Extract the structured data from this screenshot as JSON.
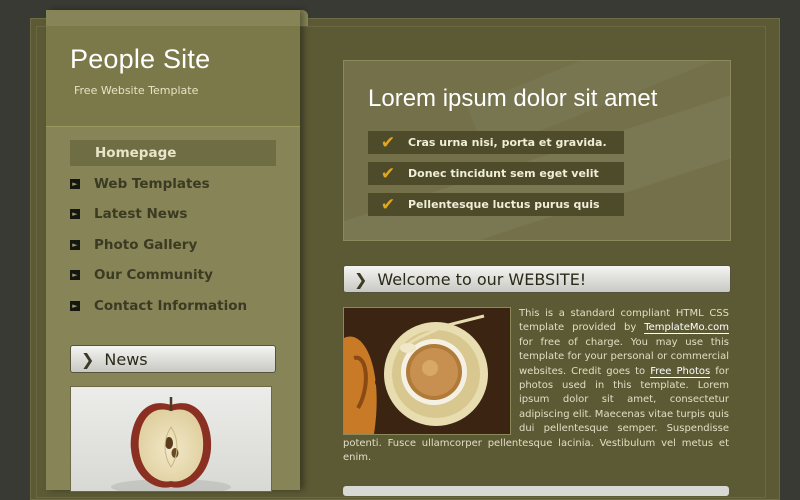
{
  "site": {
    "title": "People Site",
    "subtitle": "Free Website Template"
  },
  "nav": {
    "items": [
      {
        "label": "Homepage",
        "active": true
      },
      {
        "label": "Web Templates",
        "active": false
      },
      {
        "label": "Latest News",
        "active": false
      },
      {
        "label": "Photo Gallery",
        "active": false
      },
      {
        "label": "Our Community",
        "active": false
      },
      {
        "label": "Contact Information",
        "active": false
      }
    ]
  },
  "news": {
    "title": "News"
  },
  "hero": {
    "title": "Lorem ipsum dolor sit amet",
    "items": [
      "Cras urna nisi, porta et gravida.",
      "Donec tincidunt sem eget velit",
      "Pellentesque luctus purus quis"
    ]
  },
  "welcome": {
    "title": "Welcome to our WEBSITE!",
    "text_1": "This is a standard compliant HTML CSS template provided by",
    "link_1": "TemplateMo.com",
    "text_2": "for free of charge. You may use this template for your personal or commercial websites. Credit goes to",
    "link_2": "Free Photos",
    "text_3": "for photos used in this template. Lorem ipsum dolor sit amet, consectetur adipiscing elit. Maecenas vitae turpis quis dui pellentesque semper. Suspendisse potenti. Fusce ullamcorper pellentesque lacinia. Vestibulum vel metus et enim."
  },
  "colors": {
    "background": "#3a3a34",
    "sidebar": "#878557",
    "content": "#5c5a35",
    "check": "#e0a820"
  },
  "icons": {
    "nav_bullet": "arrow-right-icon",
    "bar_chevron": "chevron-right-icon",
    "hero_check": "check-icon"
  }
}
